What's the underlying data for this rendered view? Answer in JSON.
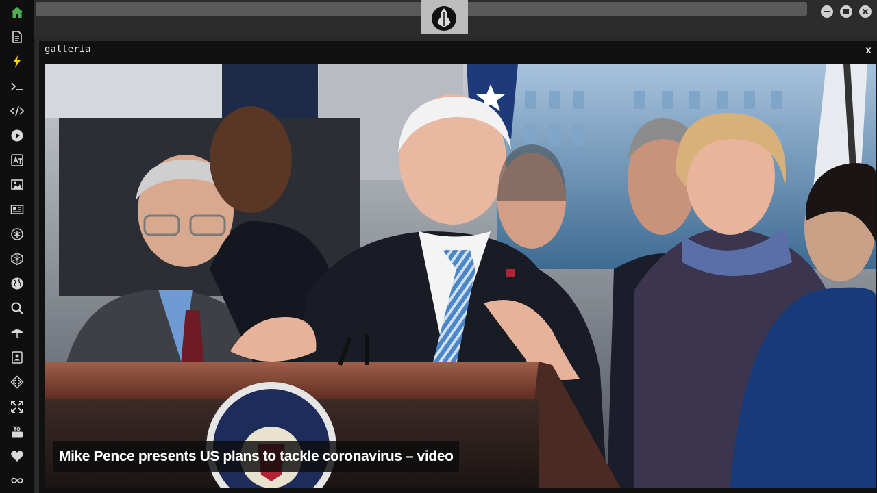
{
  "app": {
    "window_title": "galleria",
    "close_label": "x"
  },
  "sidebar": {
    "items": [
      {
        "icon": "home-icon",
        "active": true
      },
      {
        "icon": "document-icon"
      },
      {
        "icon": "lightning-icon"
      },
      {
        "icon": "terminal-icon"
      },
      {
        "icon": "code-icon"
      },
      {
        "icon": "play-icon"
      },
      {
        "icon": "translate-icon"
      },
      {
        "icon": "image-icon"
      },
      {
        "icon": "newspaper-icon"
      },
      {
        "icon": "asterisk-icon"
      },
      {
        "icon": "hexagon-icon"
      },
      {
        "icon": "globe-icon"
      },
      {
        "icon": "search-icon"
      },
      {
        "icon": "umbrella-icon"
      },
      {
        "icon": "contact-icon"
      },
      {
        "icon": "diamond-code-icon"
      },
      {
        "icon": "expand-icon"
      },
      {
        "icon": "youtube-icon"
      },
      {
        "icon": "heart-icon"
      },
      {
        "icon": "infinity-icon"
      }
    ],
    "accent_color": "#4caf50"
  },
  "topbar": {
    "logo_icon": "rebel-alliance-icon",
    "window_buttons": [
      "minimize-icon",
      "maximize-icon",
      "close-icon"
    ]
  },
  "gallery": {
    "caption": "Mike Pence presents US plans to tackle coronavirus – video"
  }
}
